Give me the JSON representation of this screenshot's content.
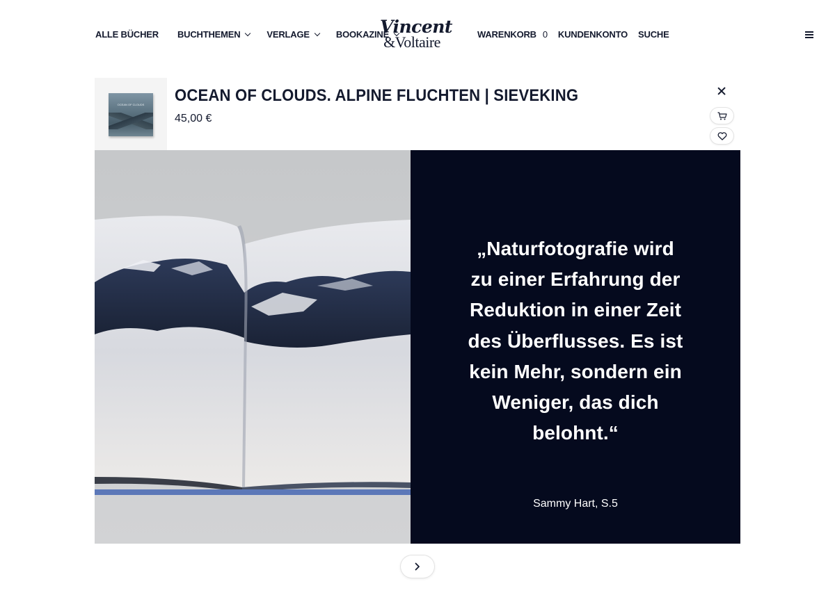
{
  "header": {
    "nav_left": [
      {
        "label": "ALLE BÜCHER",
        "dropdown": false
      },
      {
        "label": "BUCHTHEMEN",
        "dropdown": true
      },
      {
        "label": "VERLAGE",
        "dropdown": true
      },
      {
        "label": "BOOKAZINE",
        "dropdown": true
      }
    ],
    "logo": {
      "line1": "Vincent",
      "line2": "&Voltaire"
    },
    "cart_label": "WARENKORB",
    "cart_count": "0",
    "account_label": "KUNDENKONTO",
    "search_label": "SUCHE"
  },
  "product": {
    "title": "OCEAN OF CLOUDS. ALPINE FLUCHTEN | SIEVEKING",
    "price": "45,00 €",
    "thumb_title": "OCEAN OF CLOUDS"
  },
  "slide": {
    "quote": "„Naturfotografie wird zu einer Erfahrung der Reduktion in einer Zeit des Überflusses. Es ist kein Mehr, sondern ein Weniger, das dich belohnt.“",
    "author": "Sammy Hart, S.5"
  },
  "colors": {
    "navy": "#050a1e",
    "text": "#141a2e"
  }
}
